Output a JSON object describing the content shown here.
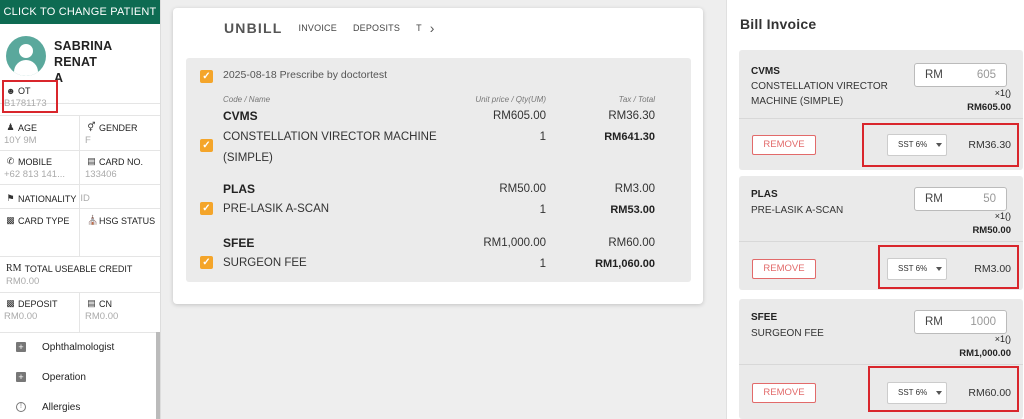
{
  "patient_panel": {
    "change_patient_label": "CLICK TO CHANGE PATIENT",
    "name_line1": "SABRINA RENAT",
    "name_line2": "A",
    "ot_label": "OT",
    "ot_value": "B1781173",
    "age_label": "AGE",
    "age_value": "10Y 9M",
    "gender_label": "GENDER",
    "gender_value": "F",
    "mobile_label": "MOBILE",
    "mobile_value": "+62 813 141...",
    "card_no_label": "CARD NO.",
    "card_no_value": "133406",
    "nationality_label": "NATIONALITY",
    "nationality_value": "ID",
    "card_type_label": "CARD TYPE",
    "hsg_status_label": "HSG STATUS",
    "credit_label": "TOTAL USEABLE CREDIT",
    "credit_icon_text": "RM",
    "credit_value": "RM0.00",
    "deposit_label": "DEPOSIT",
    "deposit_value": "RM0.00",
    "cn_label": "CN",
    "cn_value": "RM0.00",
    "menu": [
      {
        "label": "Ophthalmologist",
        "icon": "plus-box-icon"
      },
      {
        "label": "Operation",
        "icon": "plus-box-icon"
      },
      {
        "label": "Allergies",
        "icon": "exclamation-circle-icon"
      }
    ]
  },
  "unbill": {
    "tab_main": "UNBILL",
    "tabs": [
      "INVOICE",
      "DEPOSITS",
      "T"
    ],
    "group_title": "2025-08-18 Prescribe by doctortest",
    "col_code_name": "Code / Name",
    "col_unit_qty": "Unit price / Qty(UM)",
    "col_tax_total": "Tax / Total",
    "items": [
      {
        "code": "CVMS",
        "name_line1": "CONSTELLATION VIRECTOR MACHINE",
        "name_line2": "(SIMPLE)",
        "unit_price": "RM605.00",
        "qty": "1",
        "tax": "RM36.30",
        "total": "RM641.30"
      },
      {
        "code": "PLAS",
        "name_line1": "PRE-LASIK A-SCAN",
        "name_line2": "",
        "unit_price": "RM50.00",
        "qty": "1",
        "tax": "RM3.00",
        "total": "RM53.00"
      },
      {
        "code": "SFEE",
        "name_line1": "SURGEON FEE",
        "name_line2": "",
        "unit_price": "RM1,000.00",
        "qty": "1",
        "tax": "RM60.00",
        "total": "RM1,060.00"
      }
    ]
  },
  "bill_invoice": {
    "title": "Bill Invoice",
    "remove_label": "REMOVE",
    "currency": "RM",
    "items": [
      {
        "code": "CVMS",
        "desc_line1": "CONSTELLATION VIRECTOR",
        "desc_line2": "MACHINE (SIMPLE)",
        "price_input": "605",
        "qty": "×1()",
        "total": "RM605.00",
        "tax_option": "SST 6%",
        "tax_amount": "RM36.30"
      },
      {
        "code": "PLAS",
        "desc_line1": "PRE-LASIK A-SCAN",
        "desc_line2": "",
        "price_input": "50",
        "qty": "×1()",
        "total": "RM50.00",
        "tax_option": "SST 6%",
        "tax_amount": "RM3.00"
      },
      {
        "code": "SFEE",
        "desc_line1": "SURGEON FEE",
        "desc_line2": "",
        "price_input": "1000",
        "qty": "×1()",
        "total": "RM1,000.00",
        "tax_option": "SST 6%",
        "tax_amount": "RM60.00"
      }
    ]
  },
  "colors": {
    "brand_green": "#0e6b52",
    "checkbox_orange": "#f4a52a",
    "remove_red": "#e26a6a",
    "highlight_red": "#d9262c"
  }
}
